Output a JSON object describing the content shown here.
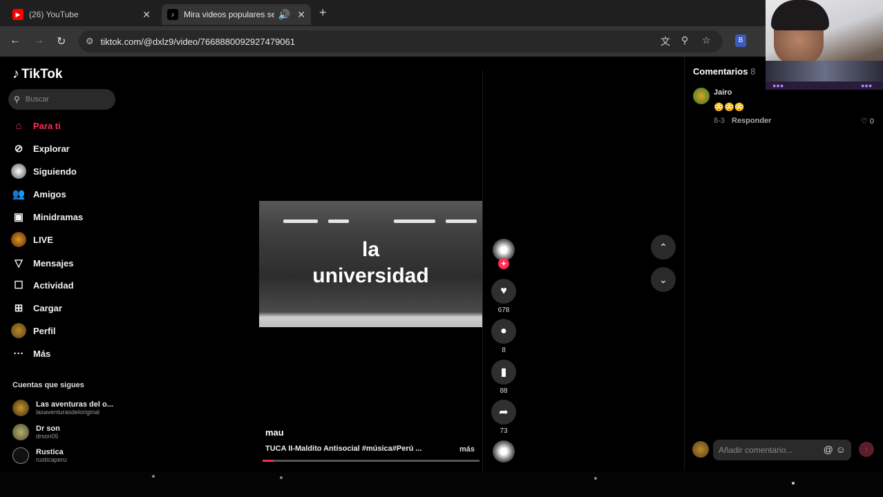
{
  "browser": {
    "tabs": [
      {
        "title": "(26) YouTube",
        "favicon": "youtube-icon"
      },
      {
        "title": "Mira videos populares selec",
        "favicon": "tiktok-icon"
      }
    ],
    "url": "tiktok.com/@dxlz9/video/7668880092927479061"
  },
  "sidebar": {
    "logo": "TikTok",
    "search_placeholder": "Buscar",
    "nav": [
      {
        "label": "Para ti",
        "icon": "home-icon"
      },
      {
        "label": "Explorar",
        "icon": "compass-icon"
      },
      {
        "label": "Siguiendo",
        "icon": "following-avatar-icon"
      },
      {
        "label": "Amigos",
        "icon": "friends-icon"
      },
      {
        "label": "Minidramas",
        "icon": "film-icon"
      },
      {
        "label": "LIVE",
        "icon": "live-icon"
      },
      {
        "label": "Mensajes",
        "icon": "send-icon"
      },
      {
        "label": "Actividad",
        "icon": "activity-icon"
      },
      {
        "label": "Cargar",
        "icon": "upload-icon"
      },
      {
        "label": "Perfil",
        "icon": "profile-avatar-icon"
      },
      {
        "label": "Más",
        "icon": "more-icon"
      }
    ],
    "following_title": "Cuentas que sigues",
    "following": [
      {
        "name": "Las aventuras del o...",
        "handle": "lasaventurasdeloriginal"
      },
      {
        "name": "Dr son",
        "handle": "drson05"
      },
      {
        "name": "Rustica",
        "handle": "rusticaperu"
      }
    ]
  },
  "video": {
    "overlay_line1": "la",
    "overlay_line2": "universidad",
    "author": "mau",
    "caption": "TUCA II-Maldito Antisocial #música#Perú ...",
    "more": "más",
    "progress": 0.05
  },
  "actions": {
    "likes": "678",
    "comments": "8",
    "saves": "88",
    "shares": "73"
  },
  "comments_panel": {
    "title": "Comentarios",
    "count": "8",
    "items": [
      {
        "user": "Jairo",
        "text": "😳😳😳",
        "date": "8-3",
        "reply": "Responder",
        "likes": "0"
      }
    ],
    "input_placeholder": "Añadir comentario..."
  },
  "colors": {
    "accent": "#fe2c55",
    "background": "#000000"
  }
}
